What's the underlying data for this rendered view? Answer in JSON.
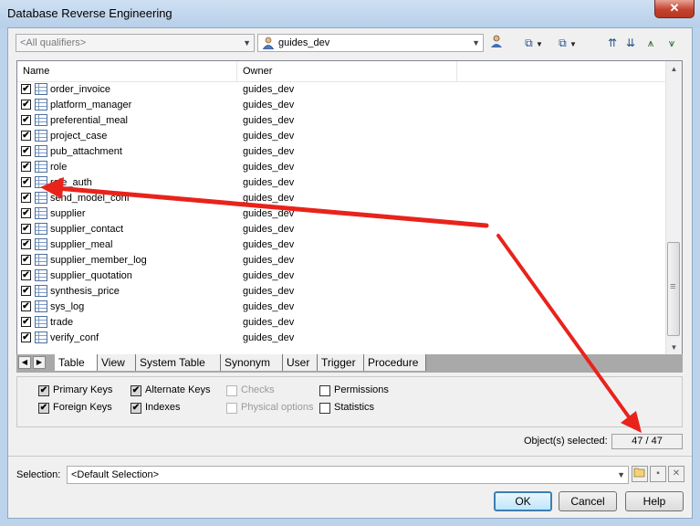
{
  "window": {
    "title": "Database Reverse Engineering",
    "close_glyph": "✕"
  },
  "toolbar": {
    "qualifier": {
      "value": "<All qualifiers>"
    },
    "owner": {
      "value": "guides_dev"
    },
    "icons": [
      "owner-icon",
      "select-all-icon",
      "deselect-icon",
      "move-up-icon",
      "move-down-icon",
      "filter-icon",
      "filter-clear-icon"
    ]
  },
  "list": {
    "columns": [
      "Name",
      "Owner"
    ],
    "rows": [
      {
        "name": "order_invoice",
        "owner": "guides_dev",
        "checked": true
      },
      {
        "name": "platform_manager",
        "owner": "guides_dev",
        "checked": true
      },
      {
        "name": "preferential_meal",
        "owner": "guides_dev",
        "checked": true
      },
      {
        "name": "project_case",
        "owner": "guides_dev",
        "checked": true
      },
      {
        "name": "pub_attachment",
        "owner": "guides_dev",
        "checked": true
      },
      {
        "name": "role",
        "owner": "guides_dev",
        "checked": true
      },
      {
        "name": "role_auth",
        "owner": "guides_dev",
        "checked": true
      },
      {
        "name": "send_model_conf",
        "owner": "guides_dev",
        "checked": true
      },
      {
        "name": "supplier",
        "owner": "guides_dev",
        "checked": true
      },
      {
        "name": "supplier_contact",
        "owner": "guides_dev",
        "checked": true
      },
      {
        "name": "supplier_meal",
        "owner": "guides_dev",
        "checked": true
      },
      {
        "name": "supplier_member_log",
        "owner": "guides_dev",
        "checked": true
      },
      {
        "name": "supplier_quotation",
        "owner": "guides_dev",
        "checked": true
      },
      {
        "name": "synthesis_price",
        "owner": "guides_dev",
        "checked": true
      },
      {
        "name": "sys_log",
        "owner": "guides_dev",
        "checked": true
      },
      {
        "name": "trade",
        "owner": "guides_dev",
        "checked": true
      },
      {
        "name": "verify_conf",
        "owner": "guides_dev",
        "checked": true
      }
    ]
  },
  "tabs": [
    "Table",
    "View",
    "System Table",
    "Synonym",
    "User",
    "Trigger",
    "Procedure"
  ],
  "active_tab": "Table",
  "options": {
    "primary_keys": "Primary Keys",
    "foreign_keys": "Foreign Keys",
    "alternate_keys": "Alternate Keys",
    "indexes": "Indexes",
    "checks": "Checks",
    "physical_options": "Physical options",
    "permissions": "Permissions",
    "statistics": "Statistics"
  },
  "status": {
    "label": "Object(s) selected:",
    "count": "47 / 47"
  },
  "selection": {
    "label": "Selection:",
    "value": "<Default Selection>"
  },
  "buttons": {
    "ok": "OK",
    "cancel": "Cancel",
    "help": "Help"
  },
  "check_glyph": "✔",
  "annotation_color": "#e8231b"
}
